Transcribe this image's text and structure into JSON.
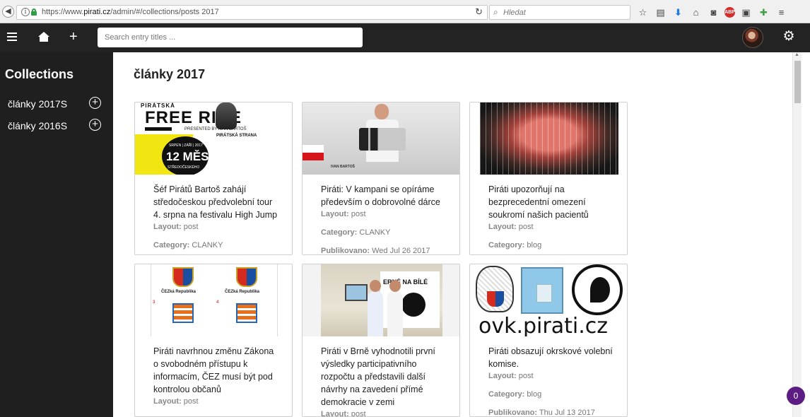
{
  "browser": {
    "url_prefix": "https://www.",
    "url_host": "pirati.cz",
    "url_path": "/admin/#/collections/posts 2017",
    "search_placeholder": "Hledat",
    "abp_label": "ABP"
  },
  "appbar": {
    "search_placeholder": "Search entry titles ..."
  },
  "sidebar": {
    "heading": "Collections",
    "items": [
      {
        "label": "články 2017S"
      },
      {
        "label": "články 2016S"
      }
    ]
  },
  "main": {
    "title": "články 2017",
    "layout_label": "Layout:",
    "category_label": "Category:",
    "published_label": "Publikovano:",
    "cards": [
      {
        "title": "Šéf Pirátů Bartoš zahájí středočeskou předvolební tour 4. srpna na festivalu High Jump",
        "layout": "post",
        "category": "CLANKY"
      },
      {
        "title": "Piráti: V kampani se opíráme především o dobrovolné dárce",
        "layout": "post",
        "category": "CLANKY",
        "published": "Wed Jul 26 2017"
      },
      {
        "title": "Piráti upozorňují na bezprecedentní omezení soukromí našich pacientů",
        "layout": "post",
        "category": "blog"
      },
      {
        "title": "Piráti navrhnou změnu Zákona o svobodném přístupu k informacím, ČEZ musí být pod kontrolou občanů",
        "layout": "post"
      },
      {
        "title": "Piráti v Brně vyhodnotili první výsledky participativního rozpočtu a představili další návrhy na zavedení přímé demokracie v zemi",
        "layout": "post"
      },
      {
        "title": "Piráti obsazují okrskové volební komise.",
        "layout": "post",
        "category": "blog",
        "published": "Thu Jul 13 2017"
      }
    ],
    "thumbs": {
      "t1_brand": "PIRÁTSKÁ",
      "t1_title": "FREE RIDE",
      "t1_presented": "PRESENTED BY IVAN BARTOŠ",
      "t1_date": "SRPEN | ZÁŘÍ | 2017",
      "t1_big": "12 MĚST",
      "t1_region": "STŘEDOČESKÉHO",
      "t1_logo": "PIRÁTSKÁ STRANA",
      "t2_tag": "IVAN BARTOŠ",
      "t4_cap": "ČEZká Republika",
      "t4_n3": "3",
      "t4_n4": "4",
      "t5_banner": "ERNÉ NA BÍLÉ",
      "t6_text": "ovk.pirati.cz"
    }
  },
  "notification_count": "0"
}
